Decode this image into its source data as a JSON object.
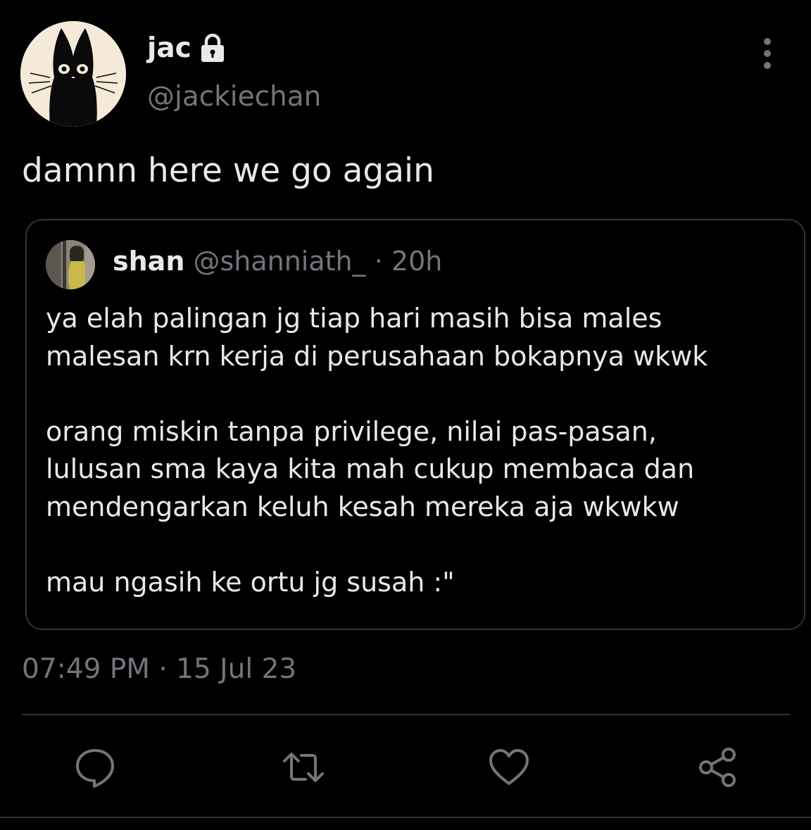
{
  "tweet": {
    "author": {
      "display_name": "jac",
      "handle": "@jackiechan",
      "avatar_icon": "black-cat-icon",
      "protected_icon": "lock-icon"
    },
    "text": "damnn here we go again",
    "quote": {
      "author_name": "shan",
      "author_handle": "@shanniath_",
      "separator": "·",
      "time": "20h",
      "paragraphs": [
        [
          "ya elah palingan jg tiap hari masih bisa males",
          "malesan krn kerja di perusahaan bokapnya wkwk"
        ],
        [
          "orang miskin tanpa privilege, nilai pas-pasan,",
          "lulusan sma kaya kita mah cukup membaca dan",
          "mendengarkan keluh kesah mereka aja wkwkw"
        ],
        [
          "mau ngasih ke ortu jg susah :\""
        ]
      ]
    },
    "timestamp": "07:49 PM · 15 Jul 23"
  },
  "actions": [
    {
      "name": "reply",
      "icon": "comment-icon"
    },
    {
      "name": "retweet",
      "icon": "retweet-icon"
    },
    {
      "name": "like",
      "icon": "heart-icon"
    },
    {
      "name": "share",
      "icon": "share-icon"
    }
  ],
  "colors": {
    "background": "#000000",
    "primary_text": "#e7e9ea",
    "secondary_text": "#71767b",
    "border": "#2f3336",
    "avatar_bg": "#f5ead9"
  }
}
